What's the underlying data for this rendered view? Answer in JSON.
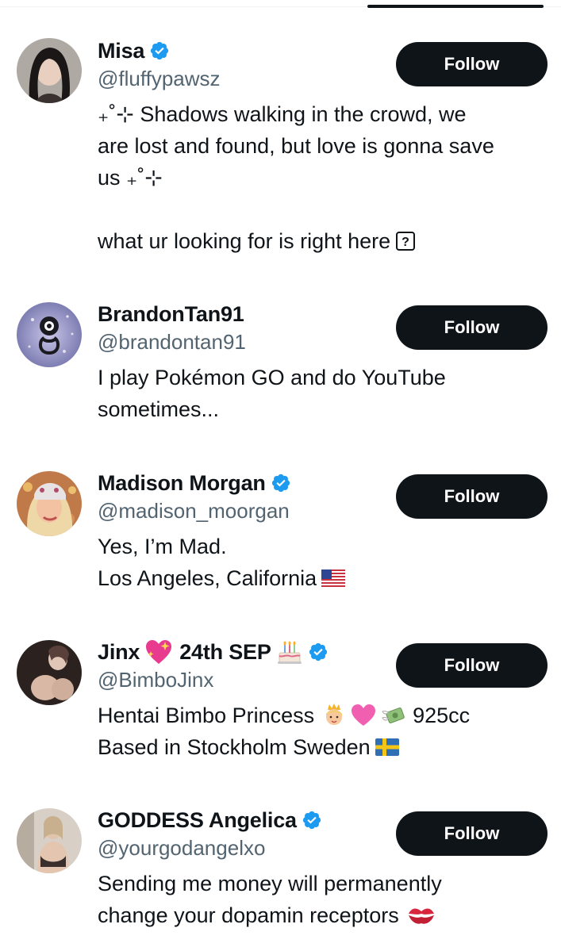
{
  "users": [
    {
      "name": "Misa",
      "name_suffix": "",
      "verified": true,
      "handle": "@fluffypawsz",
      "follow_label": "Follow",
      "bio_lines": [
        "₊˚⊹ Shadows walking in the crowd, we",
        "are lost and found, but love is gonna save",
        "us ₊˚⊹",
        "",
        "what ur looking for is right here"
      ],
      "bio_trailing_icon": "unknown-glyph-box"
    },
    {
      "name": "BrandonTan91",
      "verified": false,
      "handle": "@brandontan91",
      "follow_label": "Follow",
      "bio_lines": [
        "I play Pokémon GO and do YouTube",
        "sometimes..."
      ]
    },
    {
      "name": "Madison Morgan",
      "verified": true,
      "handle": "@madison_moorgan",
      "follow_label": "Follow",
      "bio_lines": [
        "Yes, I’m Mad.",
        "Los Angeles, California"
      ],
      "bio_trailing_icon": "us-flag"
    },
    {
      "name": "Jinx",
      "name_part2": "24th SEP",
      "name_emojis": [
        "sparkling-heart",
        "birthday-cake"
      ],
      "verified": true,
      "handle": "@BimboJinx",
      "follow_label": "Follow",
      "bio_lines": [
        "Hentai Bimbo Princess",
        "Based in Stockholm Sweden"
      ],
      "bio_line1_tail": "925cc",
      "bio_icons": [
        "princess",
        "pink-heart",
        "money-with-wings",
        "sweden-flag"
      ]
    },
    {
      "name": "GODDESS Angelica",
      "verified": true,
      "handle": "@yourgodangelxo",
      "follow_label": "Follow",
      "bio_lines": [
        "Sending me money will permanently",
        "change your dopamin receptors"
      ],
      "bio_trailing_icon": "kiss-mark"
    }
  ],
  "colors": {
    "text_primary": "#0f1419",
    "text_secondary": "#536471",
    "verified_blue": "#1d9bf0",
    "button_bg": "#0f1419",
    "button_text": "#ffffff"
  }
}
